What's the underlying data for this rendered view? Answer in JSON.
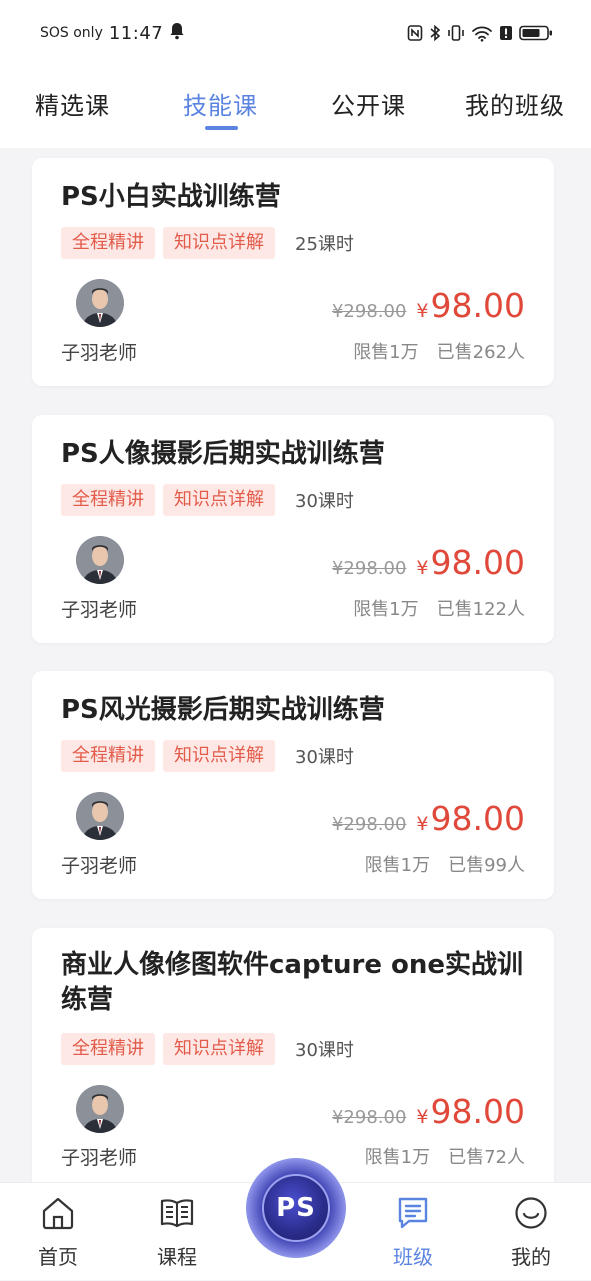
{
  "status_bar": {
    "carrier": "SOS only",
    "time": "11:47"
  },
  "top_tabs": [
    {
      "label": "精选课",
      "active": false
    },
    {
      "label": "技能课",
      "active": true
    },
    {
      "label": "公开课",
      "active": false
    },
    {
      "label": "我的班级",
      "active": false
    }
  ],
  "courses": [
    {
      "title": "PS小白实战训练营",
      "tags": [
        "全程精讲",
        "知识点详解"
      ],
      "lessons": "25课时",
      "teacher": "子羽老师",
      "old_price": "¥298.00",
      "price_symbol": "¥",
      "price": "98.00",
      "limit": "限售1万",
      "sold": "已售262人"
    },
    {
      "title": "PS人像摄影后期实战训练营",
      "tags": [
        "全程精讲",
        "知识点详解"
      ],
      "lessons": "30课时",
      "teacher": "子羽老师",
      "old_price": "¥298.00",
      "price_symbol": "¥",
      "price": "98.00",
      "limit": "限售1万",
      "sold": "已售122人"
    },
    {
      "title": "PS风光摄影后期实战训练营",
      "tags": [
        "全程精讲",
        "知识点详解"
      ],
      "lessons": "30课时",
      "teacher": "子羽老师",
      "old_price": "¥298.00",
      "price_symbol": "¥",
      "price": "98.00",
      "limit": "限售1万",
      "sold": "已售99人"
    },
    {
      "title": "商业人像修图软件capture one实战训练营",
      "tags": [
        "全程精讲",
        "知识点详解"
      ],
      "lessons": "30课时",
      "teacher": "子羽老师",
      "old_price": "¥298.00",
      "price_symbol": "¥",
      "price": "98.00",
      "limit": "限售1万",
      "sold": "已售72人"
    }
  ],
  "bottom_nav": {
    "items": [
      {
        "label": "首页",
        "icon": "home-icon",
        "active": false
      },
      {
        "label": "课程",
        "icon": "book-icon",
        "active": false
      },
      {
        "label": "班级",
        "icon": "class-icon",
        "active": true
      },
      {
        "label": "我的",
        "icon": "profile-icon",
        "active": false
      }
    ],
    "center_label": "PS"
  },
  "colors": {
    "accent": "#5b84e1",
    "price": "#e0493a",
    "tag_bg": "#fde8e6",
    "tag_text": "#e35c4b"
  }
}
